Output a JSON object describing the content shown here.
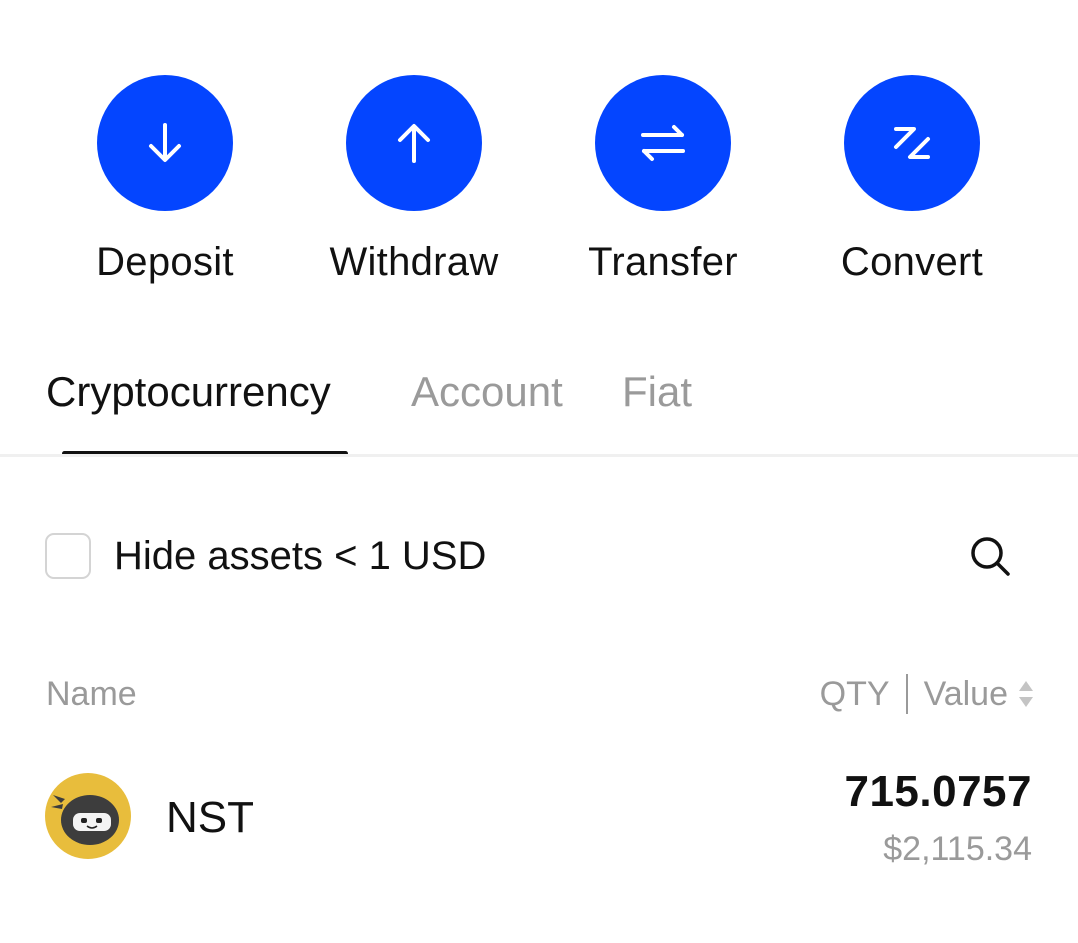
{
  "actions": [
    {
      "label": "Deposit",
      "icon": "arrow-down-icon"
    },
    {
      "label": "Withdraw",
      "icon": "arrow-up-icon"
    },
    {
      "label": "Transfer",
      "icon": "transfer-arrows-icon"
    },
    {
      "label": "Convert",
      "icon": "convert-icon"
    }
  ],
  "tabs": [
    {
      "label": "Cryptocurrency",
      "active": true
    },
    {
      "label": "Account",
      "active": false
    },
    {
      "label": "Fiat",
      "active": false
    }
  ],
  "filter": {
    "hide_small_label": "Hide assets < 1 USD",
    "checked": false,
    "search_icon": "search-icon"
  },
  "table": {
    "name_header": "Name",
    "qty_header": "QTY",
    "value_header": "Value",
    "sort_icon": "sort-icon"
  },
  "assets": [
    {
      "symbol": "NST",
      "qty": "715.0757",
      "value": "$2,115.34",
      "logo": "ninja-logo"
    }
  ],
  "colors": {
    "accent": "#0445ff",
    "text_primary": "#111111",
    "text_secondary": "#9a9a9a",
    "logo_yellow": "#e8bd3c"
  }
}
